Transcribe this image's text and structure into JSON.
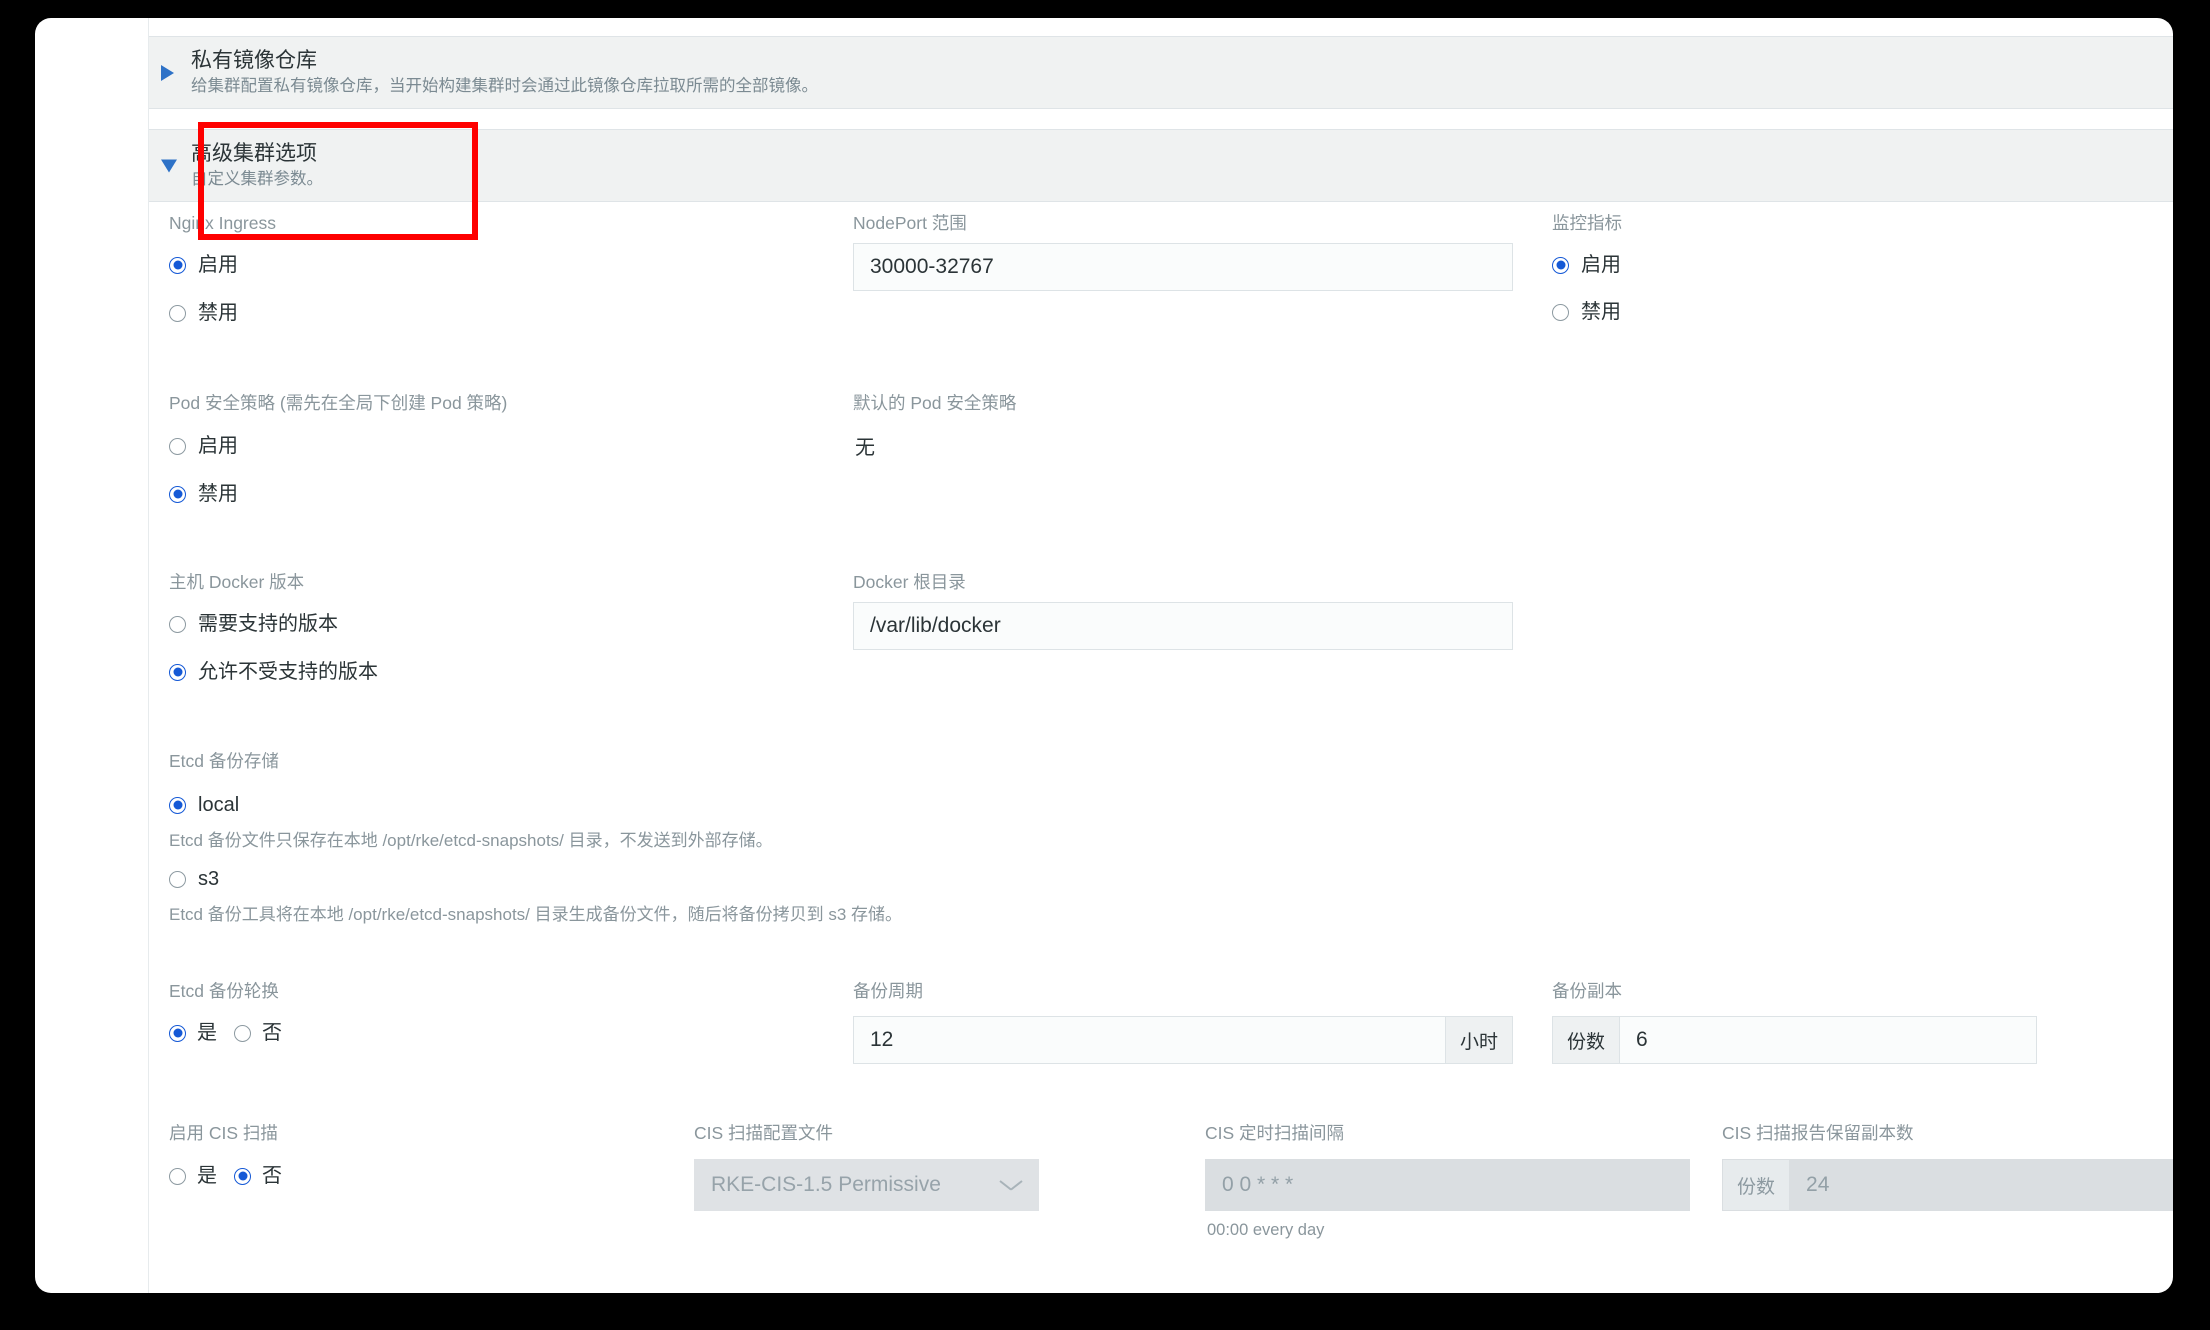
{
  "accordions": [
    {
      "title": "私有镜像仓库",
      "subtitle": "给集群配置私有镜像仓库，当开始构建集群时会通过此镜像仓库拉取所需的全部镜像。",
      "expanded": false,
      "caret": "caret-right-icon"
    },
    {
      "title": "高级集群选项",
      "subtitle": "自定义集群参数。",
      "expanded": true,
      "caret": "caret-down-icon"
    }
  ],
  "highlight": {
    "color": "#fe0000"
  },
  "form": {
    "nginx_ingress": {
      "label": "Nginx Ingress",
      "options": [
        {
          "label": "启用",
          "selected": true
        },
        {
          "label": "禁用",
          "selected": false
        }
      ]
    },
    "nodeport_range": {
      "label": "NodePort 范围",
      "value": "30000-32767"
    },
    "monitoring": {
      "label": "监控指标",
      "options": [
        {
          "label": "启用",
          "selected": true
        },
        {
          "label": "禁用",
          "selected": false
        }
      ]
    },
    "pod_security_policy": {
      "label": "Pod 安全策略 (需先在全局下创建 Pod 策略)",
      "options": [
        {
          "label": "启用",
          "selected": false
        },
        {
          "label": "禁用",
          "selected": true
        }
      ]
    },
    "default_pod_security_policy": {
      "label": "默认的 Pod 安全策略",
      "value": "无"
    },
    "host_docker_version": {
      "label": "主机 Docker 版本",
      "options": [
        {
          "label": "需要支持的版本",
          "selected": false
        },
        {
          "label": "允许不受支持的版本",
          "selected": true
        }
      ]
    },
    "docker_root_dir": {
      "label": "Docker 根目录",
      "value": "/var/lib/docker"
    },
    "etcd_backup_storage": {
      "label": "Etcd 备份存储",
      "options": [
        {
          "label": "local",
          "selected": true,
          "description": "Etcd 备份文件只保存在本地 /opt/rke/etcd-snapshots/ 目录，不发送到外部存储。"
        },
        {
          "label": "s3",
          "selected": false,
          "description": "Etcd 备份工具将在本地 /opt/rke/etcd-snapshots/ 目录生成备份文件，随后将备份拷贝到 s3 存储。"
        }
      ]
    },
    "etcd_backup_rotation": {
      "label": "Etcd 备份轮换",
      "options": [
        {
          "label": "是",
          "selected": true
        },
        {
          "label": "否",
          "selected": false
        }
      ]
    },
    "backup_period": {
      "label": "备份周期",
      "value": "12",
      "suffix": "小时"
    },
    "backup_replicas": {
      "label": "备份副本",
      "prefix": "份数",
      "value": "6"
    },
    "enable_cis_scan": {
      "label": "启用 CIS 扫描",
      "options": [
        {
          "label": "是",
          "selected": false
        },
        {
          "label": "否",
          "selected": true
        }
      ]
    },
    "cis_scan_profile": {
      "label": "CIS 扫描配置文件",
      "value": "RKE-CIS-1.5 Permissive",
      "disabled": true,
      "chevron": "chevron-down-icon"
    },
    "cis_scan_interval": {
      "label": "CIS 定时扫描间隔",
      "placeholder": "0 0 * * *",
      "hint": "00:00 every day",
      "disabled": true
    },
    "cis_report_retention": {
      "label": "CIS 扫描报告保留副本数",
      "prefix": "份数",
      "value": "24",
      "disabled": true
    }
  }
}
